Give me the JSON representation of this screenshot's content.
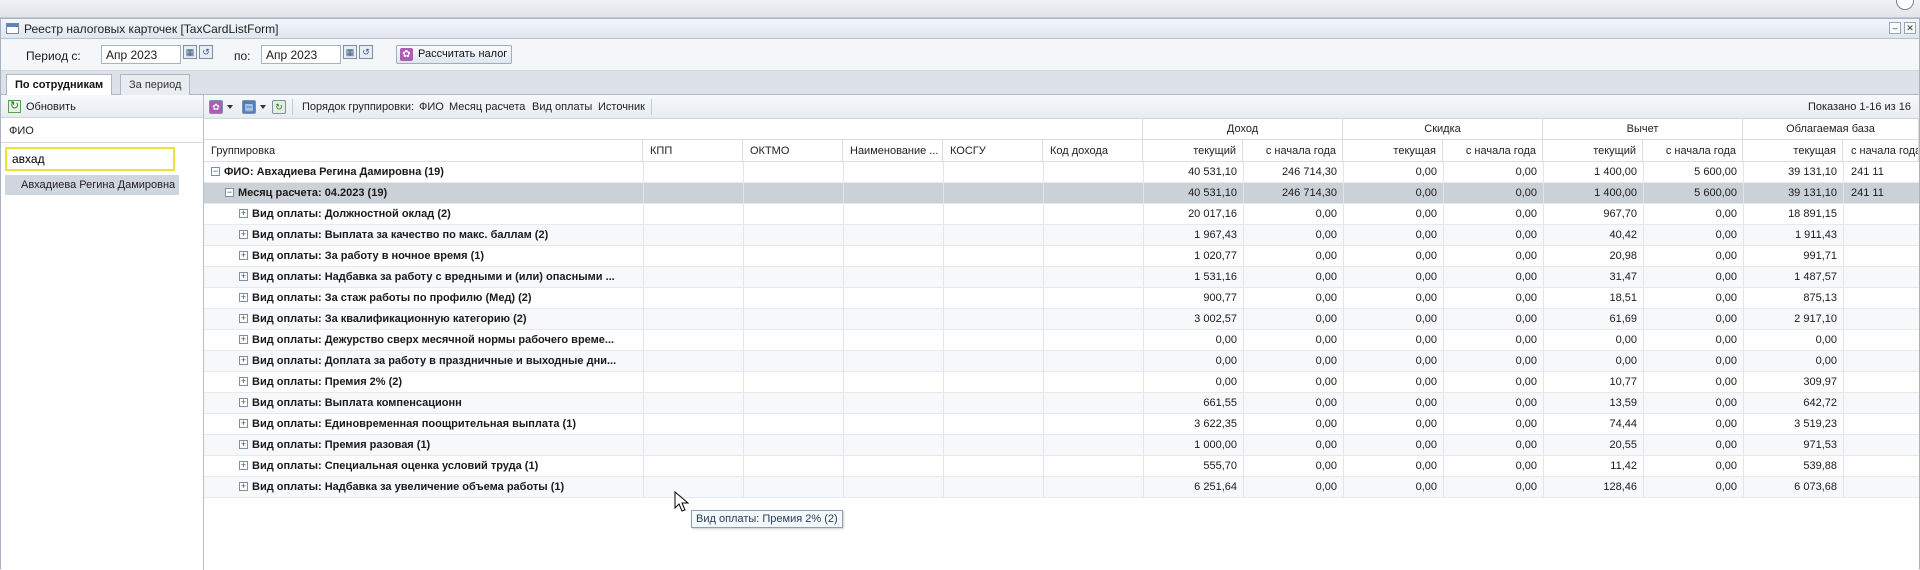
{
  "window": {
    "title": "Реестр налоговых карточек [TaxCardListForm]"
  },
  "period": {
    "from_label": "Период с:",
    "from_value": "Апр 2023",
    "to_label": "по:",
    "to_value": "Апр 2023",
    "calc_button": "Рассчитать налог"
  },
  "tabs": [
    {
      "label": "По сотрудникам"
    },
    {
      "label": "За период"
    }
  ],
  "left_panel": {
    "refresh_label": "Обновить",
    "fio_header": "ФИО",
    "search_value": "авхад",
    "employees": [
      "Авхадиева Регина Дамировна"
    ]
  },
  "toolbar": {
    "grouping_label": "Порядок группировки:",
    "group_fields": [
      "ФИО",
      "Месяц расчета",
      "Вид оплаты",
      "Источник"
    ],
    "shown_text": "Показано 1-16 из 16"
  },
  "columns": {
    "grouping": "Группировка",
    "kpp": "КПП",
    "oktmo": "ОКТМО",
    "name": "Наименование ...",
    "kosgu": "КОСГУ",
    "income_code": "Код дохода",
    "groups": [
      "Доход",
      "Скидка",
      "Вычет",
      "Облагаемая база"
    ],
    "current": "текущий",
    "current_f": "текущая",
    "ytd": "с начала года"
  },
  "rows": [
    {
      "label": "ФИО: Авхадиева Регина Дамировна (19)",
      "level": 0,
      "sign": "−",
      "values": [
        "40 531,10",
        "246 714,30",
        "0,00",
        "0,00",
        "1 400,00",
        "5 600,00",
        "39 131,10",
        "241 11"
      ]
    },
    {
      "label": "Месяц расчета: 04.2023 (19)",
      "level": 1,
      "sign": "−",
      "values": [
        "40 531,10",
        "246 714,30",
        "0,00",
        "0,00",
        "1 400,00",
        "5 600,00",
        "39 131,10",
        "241 11"
      ]
    },
    {
      "label": "Вид оплаты: Должностной оклад (2)",
      "level": 2,
      "sign": "+",
      "values": [
        "20 017,16",
        "0,00",
        "0,00",
        "0,00",
        "967,70",
        "0,00",
        "18 891,15",
        ""
      ]
    },
    {
      "label": "Вид оплаты: Выплата за качество по макс. баллам (2)",
      "level": 2,
      "sign": "+",
      "values": [
        "1 967,43",
        "0,00",
        "0,00",
        "0,00",
        "40,42",
        "0,00",
        "1 911,43",
        ""
      ]
    },
    {
      "label": "Вид оплаты: За работу в ночное время (1)",
      "level": 2,
      "sign": "+",
      "values": [
        "1 020,77",
        "0,00",
        "0,00",
        "0,00",
        "20,98",
        "0,00",
        "991,71",
        ""
      ]
    },
    {
      "label": "Вид оплаты: Надбавка за работу с вредными и (или) опасными ...",
      "level": 2,
      "sign": "+",
      "values": [
        "1 531,16",
        "0,00",
        "0,00",
        "0,00",
        "31,47",
        "0,00",
        "1 487,57",
        ""
      ]
    },
    {
      "label": "Вид оплаты: За стаж работы по профилю (Мед) (2)",
      "level": 2,
      "sign": "+",
      "values": [
        "900,77",
        "0,00",
        "0,00",
        "0,00",
        "18,51",
        "0,00",
        "875,13",
        ""
      ]
    },
    {
      "label": "Вид оплаты: За квалификационную категорию (2)",
      "level": 2,
      "sign": "+",
      "values": [
        "3 002,57",
        "0,00",
        "0,00",
        "0,00",
        "61,69",
        "0,00",
        "2 917,10",
        ""
      ]
    },
    {
      "label": "Вид оплаты: Дежурство сверх месячной нормы рабочего време...",
      "level": 2,
      "sign": "+",
      "values": [
        "0,00",
        "0,00",
        "0,00",
        "0,00",
        "0,00",
        "0,00",
        "0,00",
        ""
      ]
    },
    {
      "label": "Вид оплаты: Доплата за работу в праздничные и выходные дни...",
      "level": 2,
      "sign": "+",
      "values": [
        "0,00",
        "0,00",
        "0,00",
        "0,00",
        "0,00",
        "0,00",
        "0,00",
        ""
      ]
    },
    {
      "label": "Вид оплаты: Премия 2% (2)",
      "level": 2,
      "sign": "+",
      "values": [
        "0,00",
        "0,00",
        "0,00",
        "0,00",
        "10,77",
        "0,00",
        "309,97",
        ""
      ]
    },
    {
      "label": "Вид оплаты: Выплата компенсационн",
      "level": 2,
      "sign": "+",
      "values": [
        "661,55",
        "0,00",
        "0,00",
        "0,00",
        "13,59",
        "0,00",
        "642,72",
        ""
      ]
    },
    {
      "label": "Вид оплаты: Единовременная поощрительная выплата (1)",
      "level": 2,
      "sign": "+",
      "values": [
        "3 622,35",
        "0,00",
        "0,00",
        "0,00",
        "74,44",
        "0,00",
        "3 519,23",
        ""
      ]
    },
    {
      "label": "Вид оплаты: Премия разовая (1)",
      "level": 2,
      "sign": "+",
      "values": [
        "1 000,00",
        "0,00",
        "0,00",
        "0,00",
        "20,55",
        "0,00",
        "971,53",
        ""
      ]
    },
    {
      "label": "Вид оплаты: Специальная оценка условий труда (1)",
      "level": 2,
      "sign": "+",
      "values": [
        "555,70",
        "0,00",
        "0,00",
        "0,00",
        "11,42",
        "0,00",
        "539,88",
        ""
      ]
    },
    {
      "label": "Вид оплаты: Надбавка за увеличение объема работы (1)",
      "level": 2,
      "sign": "+",
      "values": [
        "6 251,64",
        "0,00",
        "0,00",
        "0,00",
        "128,46",
        "0,00",
        "6 073,68",
        ""
      ]
    }
  ],
  "tooltip": "Вид оплаты: Премия 2% (2)"
}
